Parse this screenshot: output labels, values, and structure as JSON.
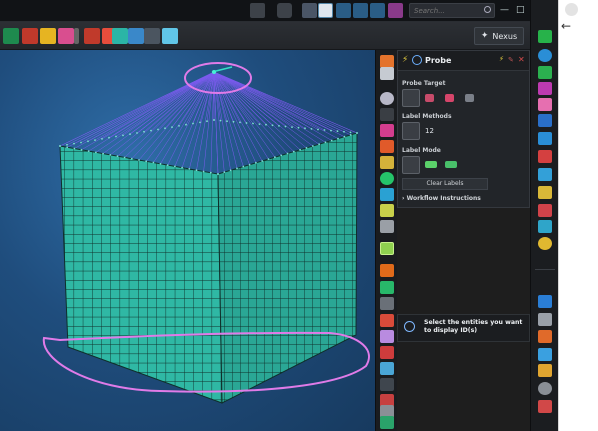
{
  "search": {
    "placeholder": "Search..."
  },
  "nexus": {
    "label": "Nexus"
  },
  "panel": {
    "title": "Probe",
    "probe_target": "Probe Target",
    "label_methods": "Label Methods",
    "label_methods_value": "12",
    "label_mode": "Label Mode",
    "clear_labels": "Clear Labels",
    "workflow": "Workflow Instructions"
  },
  "tooltip": {
    "text": "Select the entities you want to display ID(s)"
  },
  "colors": {
    "mesh_fill": "#2fb8a4",
    "mesh_line": "#10302c",
    "projection": "#8a5cff",
    "annotation": "#e07be8",
    "accent_green": "#22c35a"
  },
  "icons": {
    "topbar": [
      "view-icon",
      "camera-icon",
      "probe-icon",
      "snap-icon",
      "grid-icon",
      "pin-icon",
      "search-icon"
    ],
    "ribbon": [
      "mesh-icon",
      "geometry-icon",
      "pencil-icon",
      "tag-icon",
      "cube-icon",
      "arrow-icon",
      "select-icon",
      "transform-icon",
      "reveal-icon"
    ],
    "vertical": [
      "edit-icon",
      "visibility-icon",
      "sphere-icon",
      "dots-icon",
      "section-icon",
      "scissors-icon",
      "wrench-icon",
      "green-sphere-icon",
      "measure-icon",
      "ruler-icon",
      "node-icon",
      "probe-label-icon",
      "curve-icon",
      "edge-icon",
      "mesh-tool-icon",
      "shell-icon",
      "solid-icon",
      "tet-icon",
      "hex-icon",
      "bead-icon",
      "tri-icon",
      "quad-icon",
      "axis-icon"
    ],
    "dock": [
      "green-cube-icon",
      "globe-icon",
      "red-cube-icon",
      "layers-icon",
      "tree-icon",
      "pink-bolt-icon",
      "component-icon",
      "list-icon",
      "bars-icon",
      "chart-icon",
      "spring-icon",
      "rotate-icon",
      "light-icon",
      "nvh-icon",
      "scissors-icon",
      "blue-shape-icon",
      "tool-icon",
      "gear-icon",
      "clip-icon"
    ]
  }
}
